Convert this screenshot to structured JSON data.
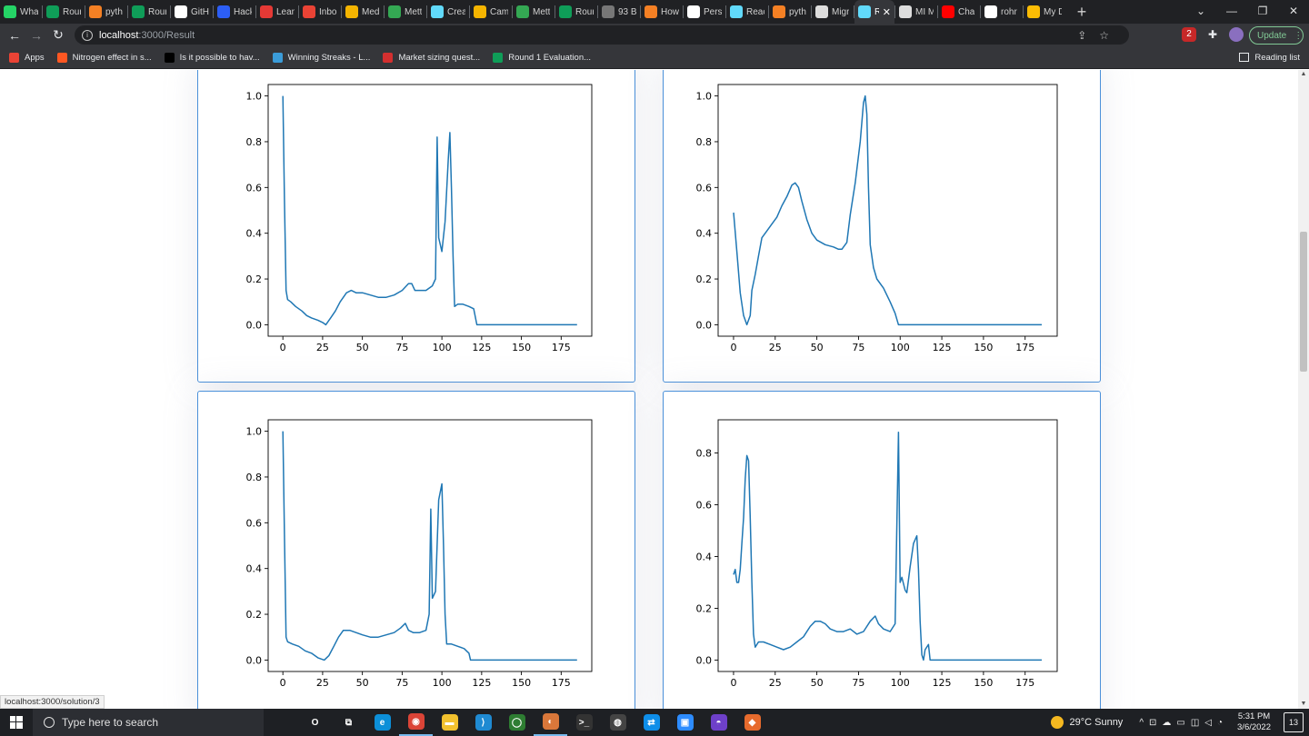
{
  "browser": {
    "tabs": [
      {
        "label": "Wha",
        "icon": "whatsapp-icon",
        "color": "#25d366"
      },
      {
        "label": "Rour",
        "icon": "sheets-icon",
        "color": "#0f9d58"
      },
      {
        "label": "pyth",
        "icon": "stackoverflow-icon",
        "color": "#f48024"
      },
      {
        "label": "Rour",
        "icon": "sheets-icon",
        "color": "#0f9d58"
      },
      {
        "label": "GitH",
        "icon": "github-icon",
        "color": "#ffffff"
      },
      {
        "label": "Hack",
        "icon": "hackerearth-icon",
        "color": "#2c5ef5"
      },
      {
        "label": "Lean",
        "icon": "w-icon",
        "color": "#e53935"
      },
      {
        "label": "Inbo",
        "icon": "gmail-icon",
        "color": "#ea4335"
      },
      {
        "label": "Med",
        "icon": "slides-icon",
        "color": "#f4b400"
      },
      {
        "label": "Mett",
        "icon": "mettl-icon",
        "color": "#34a853"
      },
      {
        "label": "Crea",
        "icon": "react-icon",
        "color": "#61dafb"
      },
      {
        "label": "Cam",
        "icon": "campus-icon",
        "color": "#f4b400"
      },
      {
        "label": "Mett",
        "icon": "mettl-icon",
        "color": "#34a853"
      },
      {
        "label": "Rour",
        "icon": "sheets-icon",
        "color": "#0f9d58"
      },
      {
        "label": "93 B",
        "icon": "bird-icon",
        "color": "#777777"
      },
      {
        "label": "How",
        "icon": "stackoverflow-icon",
        "color": "#f48024"
      },
      {
        "label": "Pers",
        "icon": "google-icon",
        "color": "#ffffff"
      },
      {
        "label": "Reac",
        "icon": "react-icon",
        "color": "#61dafb"
      },
      {
        "label": "pyth",
        "icon": "stackoverflow-icon",
        "color": "#f48024"
      },
      {
        "label": "Migr",
        "icon": "migrate-icon",
        "color": "#dddddd"
      },
      {
        "label": "R",
        "icon": "react-icon",
        "color": "#61dafb",
        "active": true
      },
      {
        "label": "MI M",
        "icon": "globe-icon",
        "color": "#dddddd"
      },
      {
        "label": "Cha",
        "icon": "youtube-icon",
        "color": "#ff0000"
      },
      {
        "label": "rohr",
        "icon": "github-icon",
        "color": "#ffffff"
      },
      {
        "label": "My D",
        "icon": "drive-icon",
        "color": "#fbbc04"
      }
    ],
    "new_tab": "+",
    "url_host": "localhost",
    "url_path": ":3000/Result",
    "update_label": "Update",
    "bookmarks": [
      {
        "label": "Apps",
        "icon": "apps-grid-icon",
        "color": "#ea4335"
      },
      {
        "label": "Nitrogen effect in s...",
        "icon": "loading-icon",
        "color": "#ff5722"
      },
      {
        "label": "Is it possible to hav...",
        "icon": "b-icon",
        "color": "#000000"
      },
      {
        "label": "Winning Streaks - L...",
        "icon": "bird-icon",
        "color": "#3b9cd9"
      },
      {
        "label": "Market sizing quest...",
        "icon": "sc-icon",
        "color": "#d32f2f"
      },
      {
        "label": "Round 1 Evaluation...",
        "icon": "sheets-icon",
        "color": "#0f9d58"
      }
    ],
    "reading_list": "Reading list",
    "status_link": "localhost:3000/solution/3"
  },
  "chart_data": [
    {
      "type": "line",
      "color": "#1f77b4",
      "xlim": [
        -9.25,
        194.25
      ],
      "ylim": [
        -0.05,
        1.05
      ],
      "xticks": [
        "0",
        "25",
        "50",
        "75",
        "100",
        "125",
        "150",
        "175"
      ],
      "yticks": [
        "0.0",
        "0.2",
        "0.4",
        "0.6",
        "0.8",
        "1.0"
      ],
      "points": [
        [
          0,
          1.0
        ],
        [
          1,
          0.55
        ],
        [
          2,
          0.15
        ],
        [
          3,
          0.11
        ],
        [
          5,
          0.1
        ],
        [
          8,
          0.08
        ],
        [
          12,
          0.06
        ],
        [
          15,
          0.04
        ],
        [
          18,
          0.03
        ],
        [
          22,
          0.02
        ],
        [
          25,
          0.01
        ],
        [
          27,
          0.0
        ],
        [
          30,
          0.03
        ],
        [
          33,
          0.06
        ],
        [
          36,
          0.1
        ],
        [
          40,
          0.14
        ],
        [
          43,
          0.15
        ],
        [
          46,
          0.14
        ],
        [
          50,
          0.14
        ],
        [
          55,
          0.13
        ],
        [
          60,
          0.12
        ],
        [
          65,
          0.12
        ],
        [
          70,
          0.13
        ],
        [
          75,
          0.15
        ],
        [
          79,
          0.18
        ],
        [
          81,
          0.18
        ],
        [
          83,
          0.15
        ],
        [
          86,
          0.15
        ],
        [
          90,
          0.15
        ],
        [
          94,
          0.17
        ],
        [
          96,
          0.2
        ],
        [
          97,
          0.82
        ],
        [
          98,
          0.38
        ],
        [
          100,
          0.32
        ],
        [
          102,
          0.45
        ],
        [
          104,
          0.72
        ],
        [
          105,
          0.84
        ],
        [
          106,
          0.6
        ],
        [
          107,
          0.3
        ],
        [
          108,
          0.08
        ],
        [
          110,
          0.09
        ],
        [
          113,
          0.09
        ],
        [
          117,
          0.08
        ],
        [
          120,
          0.07
        ],
        [
          122,
          0.0
        ],
        [
          125,
          0.0
        ],
        [
          150,
          0.0
        ],
        [
          185,
          0.0
        ]
      ]
    },
    {
      "type": "line",
      "color": "#1f77b4",
      "xlim": [
        -9.25,
        194.25
      ],
      "ylim": [
        -0.05,
        1.05
      ],
      "xticks": [
        "0",
        "25",
        "50",
        "75",
        "100",
        "125",
        "150",
        "175"
      ],
      "yticks": [
        "0.0",
        "0.2",
        "0.4",
        "0.6",
        "0.8",
        "1.0"
      ],
      "points": [
        [
          0,
          0.49
        ],
        [
          2,
          0.32
        ],
        [
          4,
          0.14
        ],
        [
          6,
          0.04
        ],
        [
          8,
          0.0
        ],
        [
          10,
          0.04
        ],
        [
          11,
          0.15
        ],
        [
          13,
          0.22
        ],
        [
          15,
          0.3
        ],
        [
          17,
          0.38
        ],
        [
          20,
          0.41
        ],
        [
          23,
          0.44
        ],
        [
          26,
          0.47
        ],
        [
          29,
          0.52
        ],
        [
          32,
          0.56
        ],
        [
          35,
          0.61
        ],
        [
          37,
          0.62
        ],
        [
          39,
          0.6
        ],
        [
          41,
          0.54
        ],
        [
          44,
          0.46
        ],
        [
          47,
          0.4
        ],
        [
          50,
          0.37
        ],
        [
          55,
          0.35
        ],
        [
          60,
          0.34
        ],
        [
          63,
          0.33
        ],
        [
          65,
          0.33
        ],
        [
          68,
          0.36
        ],
        [
          70,
          0.48
        ],
        [
          73,
          0.62
        ],
        [
          76,
          0.8
        ],
        [
          78,
          0.97
        ],
        [
          79,
          1.0
        ],
        [
          80,
          0.92
        ],
        [
          81,
          0.6
        ],
        [
          82,
          0.35
        ],
        [
          84,
          0.25
        ],
        [
          86,
          0.2
        ],
        [
          90,
          0.16
        ],
        [
          94,
          0.1
        ],
        [
          97,
          0.05
        ],
        [
          99,
          0.0
        ],
        [
          100,
          0.0
        ],
        [
          150,
          0.0
        ],
        [
          185,
          0.0
        ]
      ]
    },
    {
      "type": "line",
      "color": "#1f77b4",
      "xlim": [
        -9.25,
        194.25
      ],
      "ylim": [
        -0.05,
        1.05
      ],
      "xticks": [
        "0",
        "25",
        "50",
        "75",
        "100",
        "125",
        "150",
        "175"
      ],
      "yticks": [
        "0.0",
        "0.2",
        "0.4",
        "0.6",
        "0.8",
        "1.0"
      ],
      "points": [
        [
          0,
          1.0
        ],
        [
          1,
          0.55
        ],
        [
          2,
          0.1
        ],
        [
          3,
          0.08
        ],
        [
          6,
          0.07
        ],
        [
          10,
          0.06
        ],
        [
          14,
          0.04
        ],
        [
          18,
          0.03
        ],
        [
          22,
          0.01
        ],
        [
          26,
          0.0
        ],
        [
          29,
          0.02
        ],
        [
          32,
          0.06
        ],
        [
          35,
          0.1
        ],
        [
          38,
          0.13
        ],
        [
          42,
          0.13
        ],
        [
          46,
          0.12
        ],
        [
          50,
          0.11
        ],
        [
          55,
          0.1
        ],
        [
          60,
          0.1
        ],
        [
          65,
          0.11
        ],
        [
          70,
          0.12
        ],
        [
          74,
          0.14
        ],
        [
          77,
          0.16
        ],
        [
          79,
          0.13
        ],
        [
          82,
          0.12
        ],
        [
          86,
          0.12
        ],
        [
          90,
          0.13
        ],
        [
          92,
          0.2
        ],
        [
          93,
          0.66
        ],
        [
          94,
          0.27
        ],
        [
          96,
          0.3
        ],
        [
          98,
          0.7
        ],
        [
          100,
          0.77
        ],
        [
          101,
          0.5
        ],
        [
          102,
          0.2
        ],
        [
          103,
          0.07
        ],
        [
          106,
          0.07
        ],
        [
          110,
          0.06
        ],
        [
          114,
          0.05
        ],
        [
          117,
          0.03
        ],
        [
          118,
          0.0
        ],
        [
          125,
          0.0
        ],
        [
          150,
          0.0
        ],
        [
          185,
          0.0
        ]
      ]
    },
    {
      "type": "line",
      "color": "#1f77b4",
      "xlim": [
        -9.25,
        194.25
      ],
      "ylim": [
        -0.04419,
        0.92819
      ],
      "xticks": [
        "0",
        "25",
        "50",
        "75",
        "100",
        "125",
        "150",
        "175"
      ],
      "yticks": [
        "0.0",
        "0.2",
        "0.4",
        "0.6",
        "0.8"
      ],
      "points": [
        [
          0,
          0.33
        ],
        [
          1,
          0.35
        ],
        [
          2,
          0.3
        ],
        [
          3,
          0.3
        ],
        [
          4,
          0.35
        ],
        [
          5,
          0.45
        ],
        [
          6,
          0.55
        ],
        [
          7,
          0.7
        ],
        [
          8,
          0.79
        ],
        [
          9,
          0.77
        ],
        [
          10,
          0.55
        ],
        [
          11,
          0.3
        ],
        [
          12,
          0.1
        ],
        [
          13,
          0.05
        ],
        [
          15,
          0.07
        ],
        [
          18,
          0.07
        ],
        [
          22,
          0.06
        ],
        [
          26,
          0.05
        ],
        [
          30,
          0.04
        ],
        [
          34,
          0.05
        ],
        [
          38,
          0.07
        ],
        [
          42,
          0.09
        ],
        [
          46,
          0.13
        ],
        [
          49,
          0.15
        ],
        [
          52,
          0.15
        ],
        [
          55,
          0.14
        ],
        [
          58,
          0.12
        ],
        [
          62,
          0.11
        ],
        [
          66,
          0.11
        ],
        [
          70,
          0.12
        ],
        [
          74,
          0.1
        ],
        [
          78,
          0.11
        ],
        [
          82,
          0.15
        ],
        [
          85,
          0.17
        ],
        [
          87,
          0.14
        ],
        [
          90,
          0.12
        ],
        [
          94,
          0.11
        ],
        [
          97,
          0.14
        ],
        [
          99,
          0.88
        ],
        [
          100,
          0.3
        ],
        [
          101,
          0.32
        ],
        [
          103,
          0.27
        ],
        [
          104,
          0.26
        ],
        [
          106,
          0.36
        ],
        [
          108,
          0.45
        ],
        [
          110,
          0.48
        ],
        [
          111,
          0.35
        ],
        [
          112,
          0.15
        ],
        [
          113,
          0.02
        ],
        [
          114,
          0.0
        ],
        [
          115,
          0.04
        ],
        [
          117,
          0.06
        ],
        [
          118,
          0.0
        ],
        [
          125,
          0.0
        ],
        [
          150,
          0.0
        ],
        [
          185,
          0.0
        ]
      ]
    }
  ],
  "taskbar": {
    "search_placeholder": "Type here to search",
    "apps": [
      {
        "name": "cortana-icon",
        "color": "#1e2024",
        "glyph": "O"
      },
      {
        "name": "task-view-icon",
        "color": "#1e2024",
        "glyph": "⧉"
      },
      {
        "name": "edge-icon",
        "color": "#0c8fd8",
        "glyph": "e"
      },
      {
        "name": "chrome-icon",
        "color": "#db4437",
        "glyph": "◉",
        "running": true
      },
      {
        "name": "file-explorer-icon",
        "color": "#f2c12e",
        "glyph": "▬"
      },
      {
        "name": "vscode-icon",
        "color": "#1f8ad2",
        "glyph": "⟩"
      },
      {
        "name": "ring-app-icon",
        "color": "#2e7d32",
        "glyph": "◯"
      },
      {
        "name": "discord-icon",
        "color": "#d9773a",
        "glyph": "◐",
        "running": true
      },
      {
        "name": "terminal-icon",
        "color": "#333333",
        "glyph": ">_"
      },
      {
        "name": "obs-icon",
        "color": "#444444",
        "glyph": "◍"
      },
      {
        "name": "teamviewer-icon",
        "color": "#0e8ee9",
        "glyph": "⇄"
      },
      {
        "name": "zoom-icon",
        "color": "#2d8cff",
        "glyph": "▣"
      },
      {
        "name": "github-desktop-icon",
        "color": "#6e40c9",
        "glyph": "◓"
      },
      {
        "name": "git-icon",
        "color": "#e76b2d",
        "glyph": "◆"
      }
    ],
    "weather": "29°C  Sunny",
    "time": "5:31 PM",
    "date": "3/6/2022",
    "notifications": "13"
  }
}
